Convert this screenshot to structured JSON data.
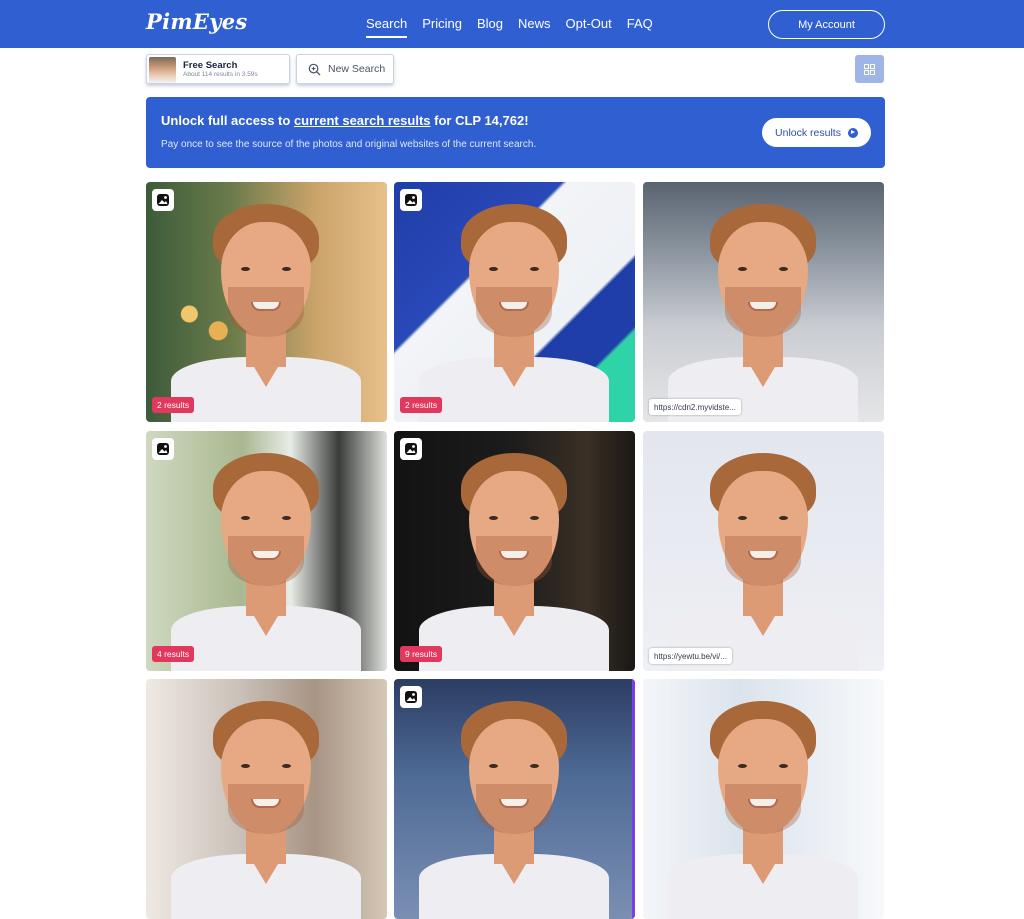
{
  "header": {
    "logo": "PimEyes",
    "nav": [
      "Search",
      "Pricing",
      "Blog",
      "News",
      "Opt-Out",
      "FAQ"
    ],
    "active_nav": "Search",
    "account_label": "My Account"
  },
  "toolbar": {
    "search_chip": {
      "title": "Free Search",
      "subtitle": "About 114 results in 3.59s"
    },
    "new_search_label": "New Search"
  },
  "banner": {
    "title_prefix": "Unlock full access to ",
    "title_link": "current search results",
    "title_suffix": " for CLP 14,762!",
    "subtitle": "Pay once to see the source of the photos and original websites of the current search.",
    "button_label": "Unlock results"
  },
  "results": [
    {
      "badge_type": "count",
      "badge": "2 results",
      "icon": true
    },
    {
      "badge_type": "count",
      "badge": "2 results",
      "icon": true
    },
    {
      "badge_type": "url",
      "badge": "https://cdn2.myvidste...",
      "icon": false
    },
    {
      "badge_type": "count",
      "badge": "4 results",
      "icon": true
    },
    {
      "badge_type": "count",
      "badge": "9 results",
      "icon": true
    },
    {
      "badge_type": "url",
      "badge": "https://yewtu.be/vi/...",
      "icon": false
    },
    {
      "badge_type": "none",
      "badge": "",
      "icon": false
    },
    {
      "badge_type": "none",
      "badge": "",
      "icon": true
    },
    {
      "badge_type": "none",
      "badge": "",
      "icon": false
    }
  ],
  "colors": {
    "brand": "#2f5fd0",
    "count_badge": "#e2385e",
    "accent_purple": "#7b3fe6"
  }
}
